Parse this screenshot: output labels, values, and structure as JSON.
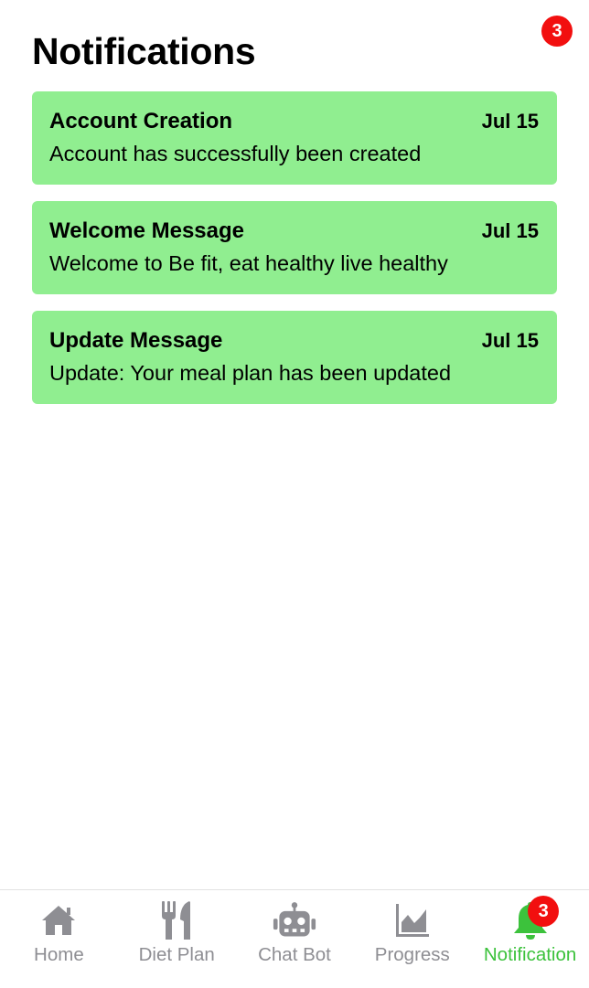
{
  "header": {
    "title": "Notifications",
    "badge_count": "3"
  },
  "notifications": [
    {
      "title": "Account Creation",
      "date": "Jul 15",
      "message": "Account has successfully been created"
    },
    {
      "title": "Welcome Message",
      "date": "Jul 15",
      "message": "Welcome to Be fit, eat healthy live healthy"
    },
    {
      "title": "Update Message",
      "date": "Jul 15",
      "message": "Update: Your meal plan has been updated"
    }
  ],
  "tabbar": {
    "tabs": [
      {
        "label": "Home",
        "icon": "home-icon"
      },
      {
        "label": "Diet Plan",
        "icon": "fork-knife-icon"
      },
      {
        "label": "Chat Bot",
        "icon": "robot-icon"
      },
      {
        "label": "Progress",
        "icon": "area-chart-icon"
      },
      {
        "label": "Notification",
        "icon": "bell-icon",
        "badge": "3",
        "active": true
      }
    ]
  },
  "colors": {
    "card_background": "#90ee90",
    "active_tab": "#3cc23c",
    "inactive_tab": "#8e8e93",
    "badge": "#f20f0f"
  }
}
